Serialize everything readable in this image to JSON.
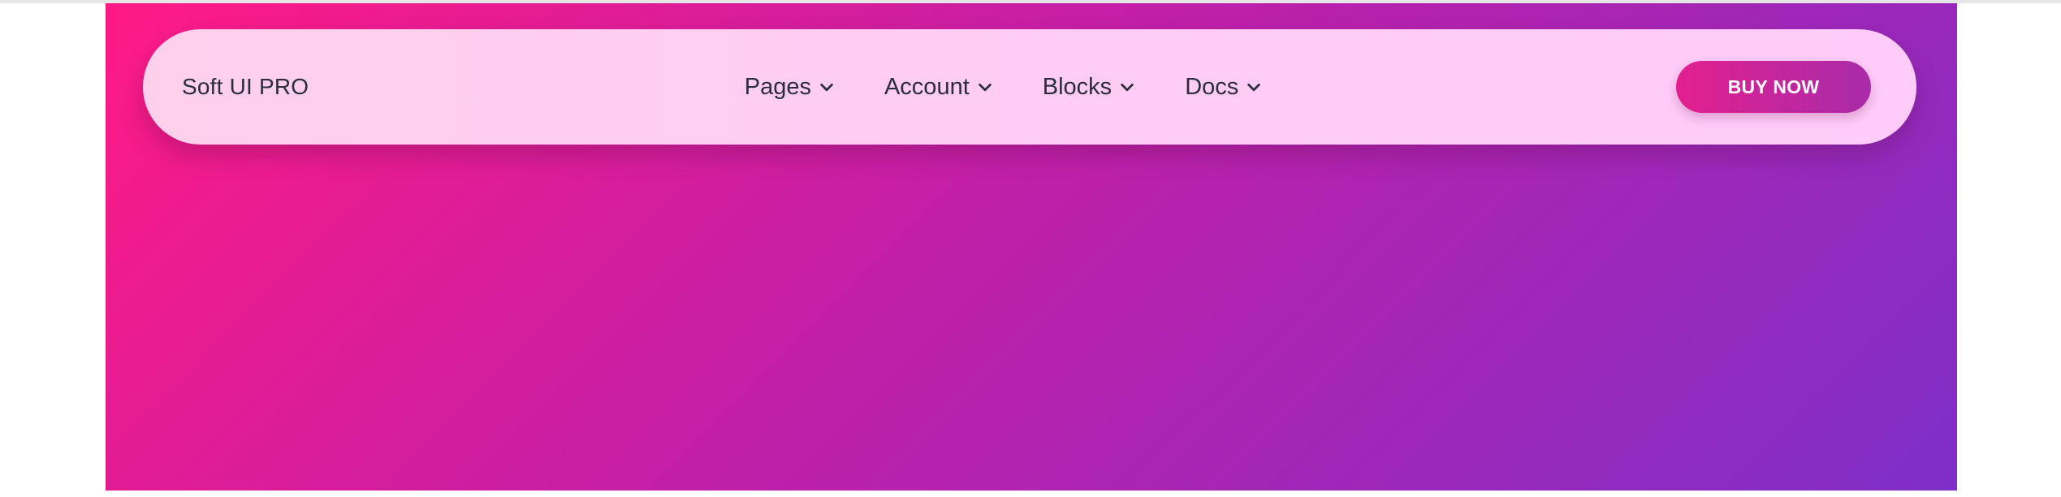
{
  "navbar": {
    "brand": "Soft UI PRO",
    "items": [
      {
        "label": "Pages",
        "icon": "chevron-down-icon"
      },
      {
        "label": "Account",
        "icon": "chevron-down-icon"
      },
      {
        "label": "Blocks",
        "icon": "chevron-down-icon"
      },
      {
        "label": "Docs",
        "icon": "chevron-down-icon"
      }
    ],
    "cta_label": "BUY NOW"
  },
  "colors": {
    "hero_gradient_start": "#ff1a85",
    "hero_gradient_end": "#7e2fc8",
    "navbar_background": "#ffccf5",
    "cta_gradient_start": "#e3208f",
    "cta_gradient_end": "#a82ba8",
    "text_dark": "#2a2c40"
  }
}
